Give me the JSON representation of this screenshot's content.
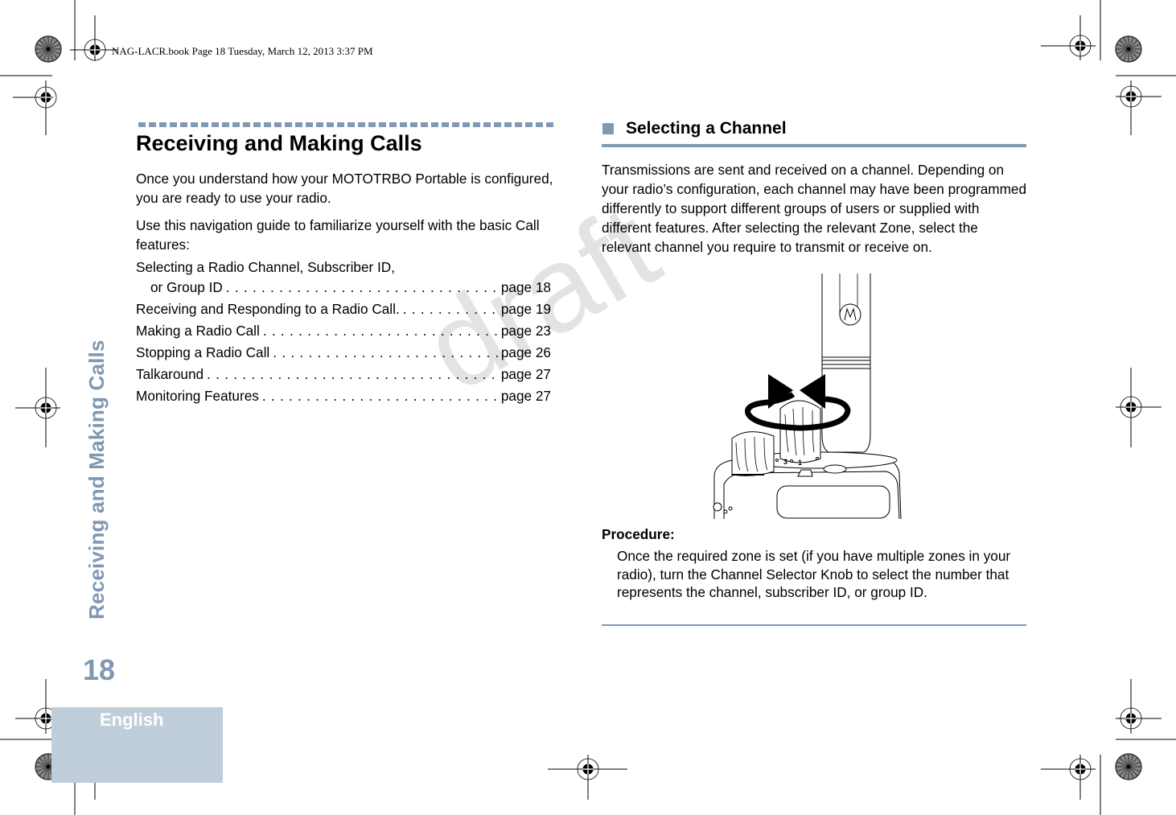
{
  "header": {
    "book_info": "NAG-LACR.book  Page 18  Tuesday, March 12, 2013  3:37 PM"
  },
  "side_tab": {
    "chapter_title": "Receiving and Making Calls",
    "page_number": "18",
    "language": "English"
  },
  "watermark": "draft",
  "left_column": {
    "title": "Receiving and Making Calls",
    "intro": "Once you understand how your MOTOTRBO Portable is configured, you are ready to use your radio.",
    "guide_intro": "Use this navigation guide to familiarize yourself with the basic Call features:",
    "toc": [
      {
        "label_line1": "Selecting a Radio Channel, Subscriber ID,",
        "label": "or Group ID",
        "page": "page 18"
      },
      {
        "label": "Receiving and Responding to a Radio Call.",
        "page": "page 19"
      },
      {
        "label": "Making a Radio Call",
        "page": "page 23"
      },
      {
        "label": "Stopping a Radio Call",
        "page": "page 26"
      },
      {
        "label": "Talkaround",
        "page": "page 27"
      },
      {
        "label": "Monitoring Features",
        "page": "page 27"
      }
    ]
  },
  "right_column": {
    "section_title": "Selecting a Channel",
    "body": "Transmissions are sent and received on a channel. Depending on your radio’s configuration, each channel may have been programmed differently to support different groups of users or supplied with different features. After selecting the relevant Zone, select the relevant channel you require to transmit or receive on.",
    "illustration": {
      "description": "Radio top view with channel selector knob and rotation arrows",
      "knob_labels": [
        "3",
        "1"
      ]
    },
    "procedure_label": "Procedure:",
    "procedure_text": "Once the required zone is set (if you have multiple zones in your radio), turn the Channel Selector Knob to select the number that represents the channel, subscriber ID, or group ID."
  },
  "colors": {
    "accent": "#8199b3",
    "side_title": "#7f98b2",
    "lang_box": "#c0cedb",
    "watermark": "#e3e3e3"
  }
}
